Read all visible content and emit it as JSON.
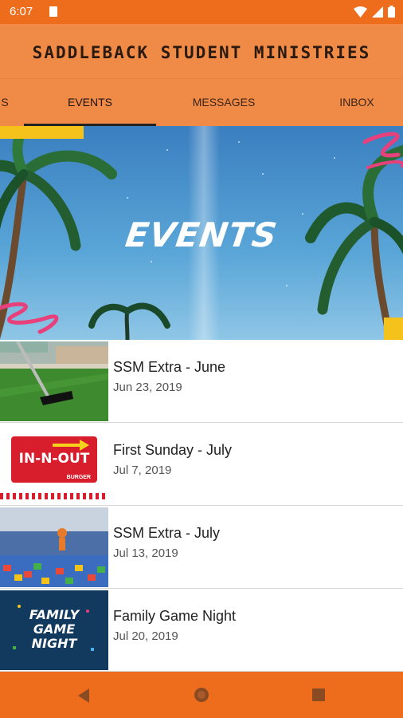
{
  "status": {
    "time": "6:07"
  },
  "header": {
    "title": "SADDLEBACK STUDENT MINISTRIES"
  },
  "tabs": [
    {
      "label": "S"
    },
    {
      "label": "EVENTS"
    },
    {
      "label": "MESSAGES"
    },
    {
      "label": "INBOX"
    }
  ],
  "active_tab": "EVENTS",
  "hero": {
    "label": "EVENTS"
  },
  "events": [
    {
      "title": "SSM Extra - June",
      "date": "Jun 23, 2019"
    },
    {
      "title": "First Sunday - July",
      "date": "Jul 7, 2019",
      "logo_text": "IN-N-OUT",
      "logo_sub": "BURGER"
    },
    {
      "title": "SSM Extra - July",
      "date": "Jul 13, 2019"
    },
    {
      "title": "Family Game Night",
      "date": "Jul 20, 2019",
      "logo_lines": [
        "FAMILY",
        "GAME",
        "NIGHT"
      ]
    }
  ],
  "colors": {
    "status": "#ee6d1c",
    "app_bar": "#f08a47",
    "accent_pink": "#e8407a",
    "innout_red": "#d81e2c"
  }
}
